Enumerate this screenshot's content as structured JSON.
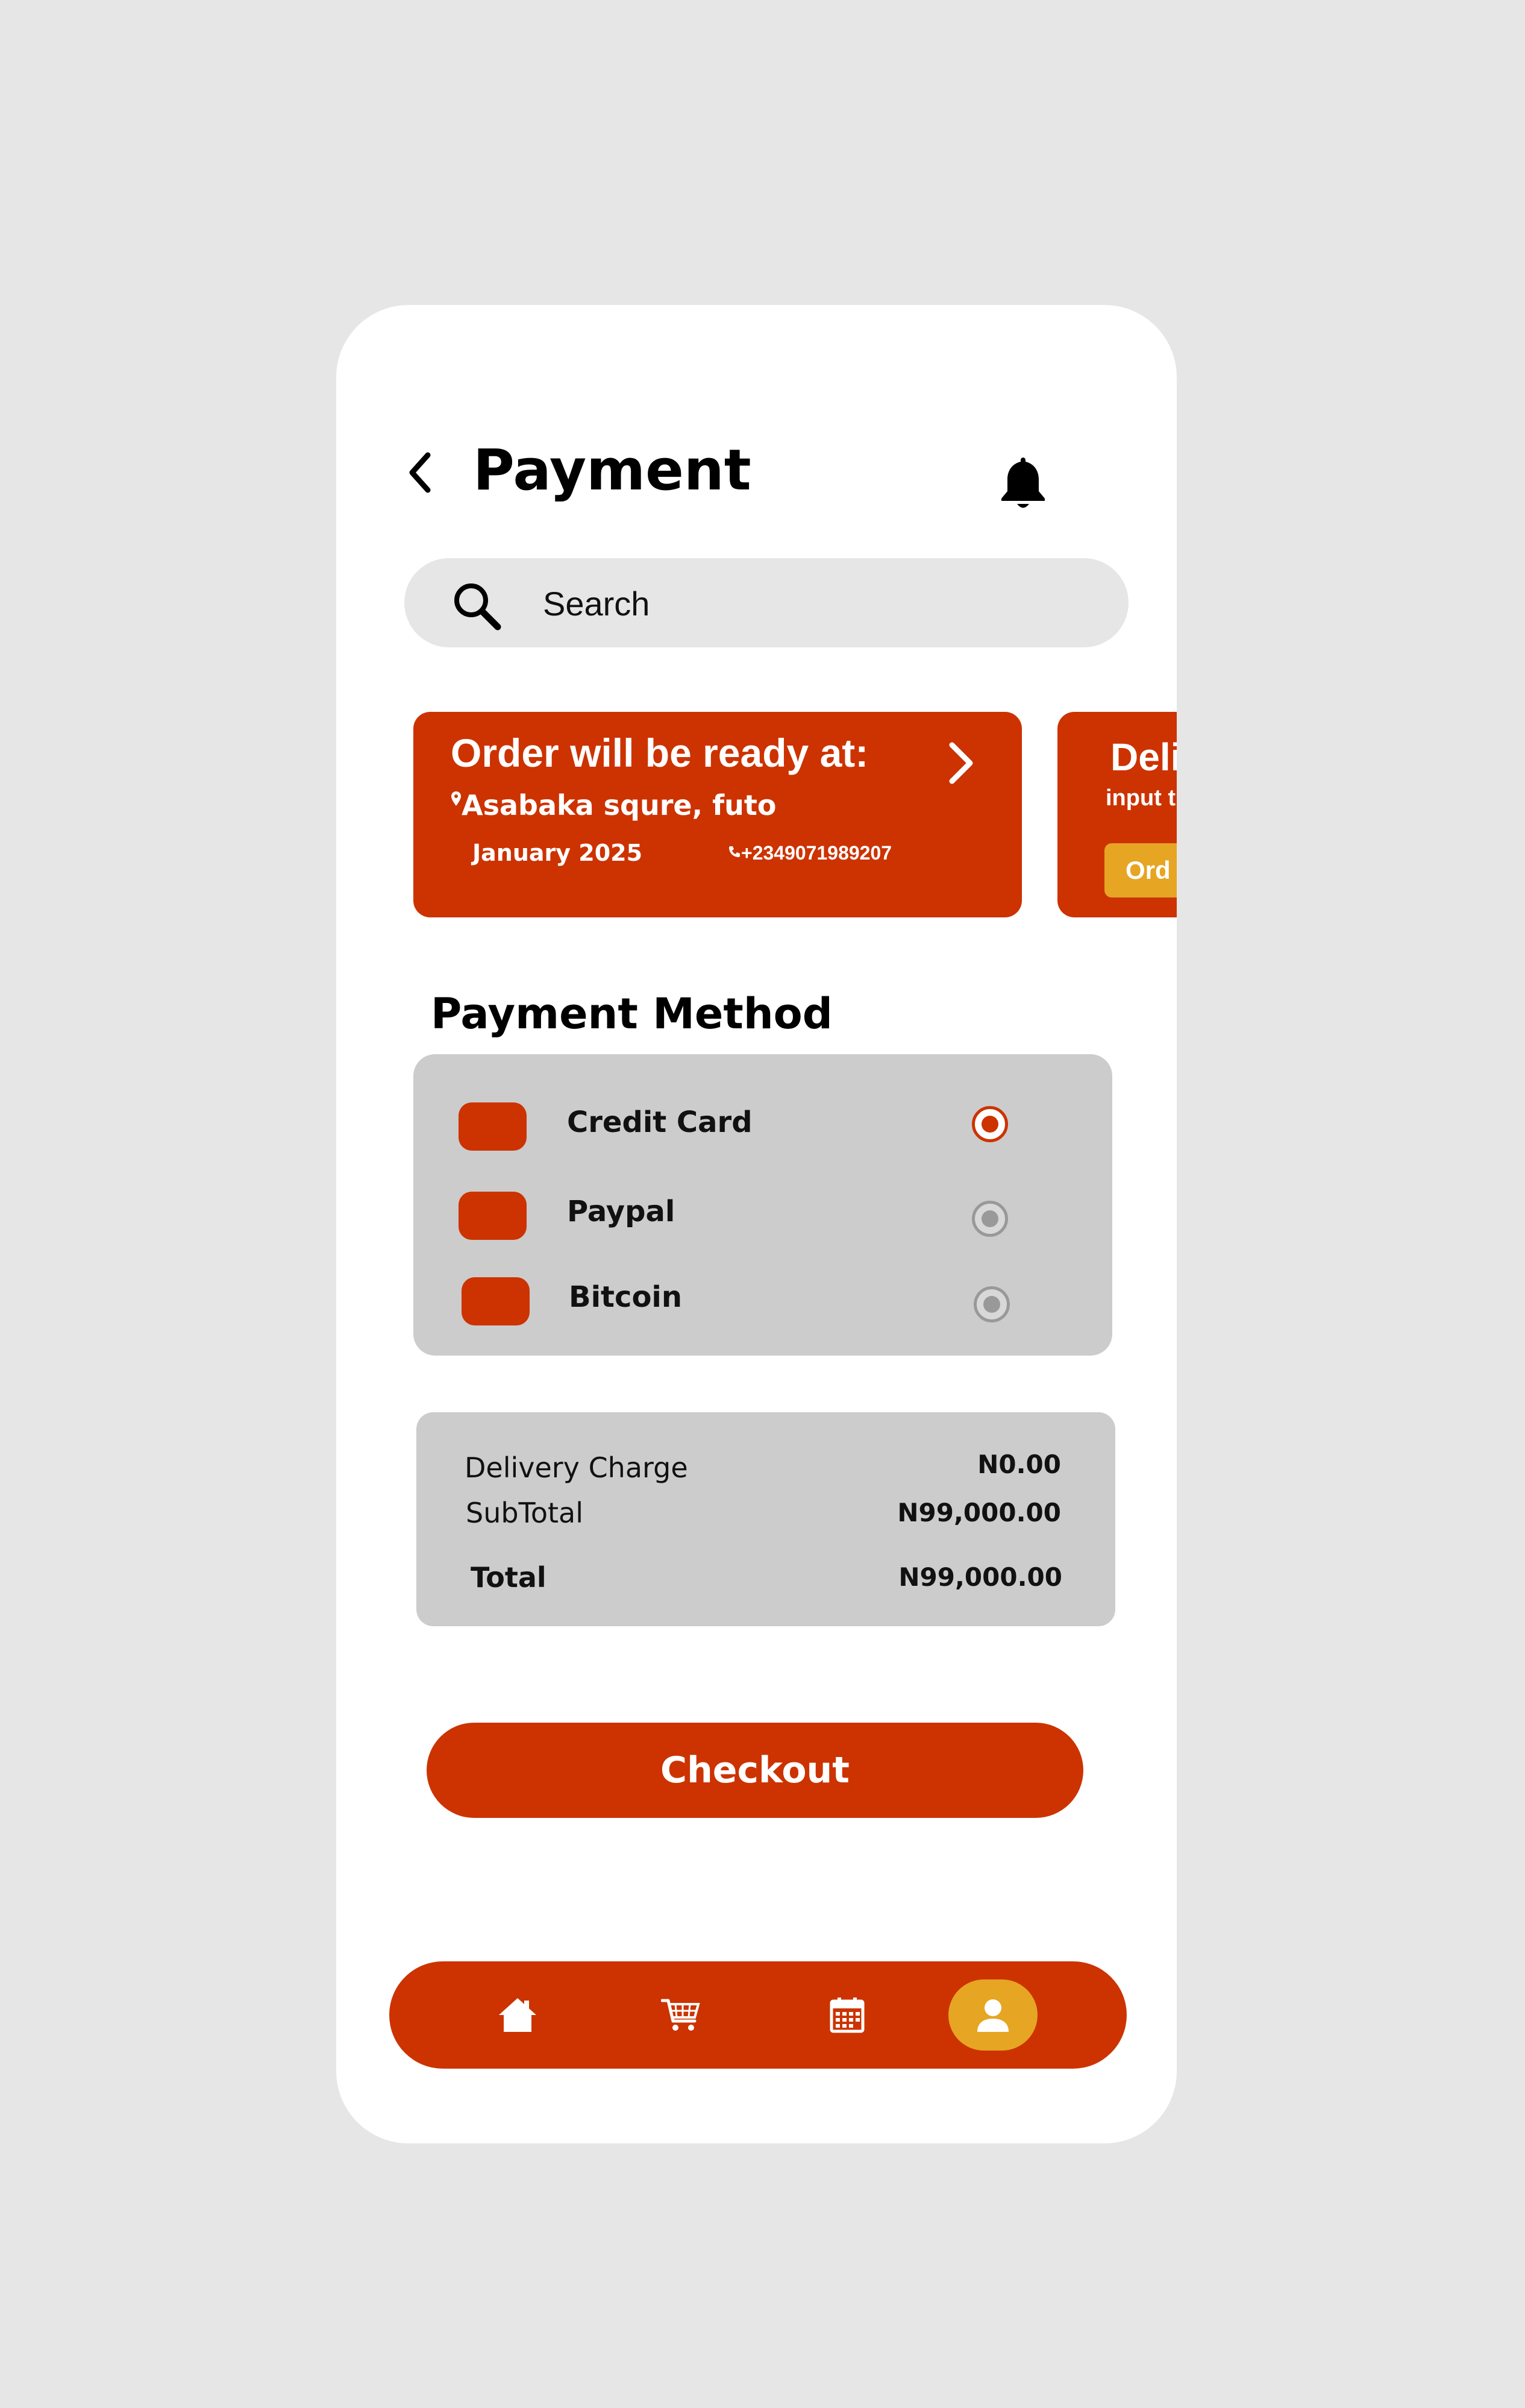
{
  "header": {
    "title": "Payment",
    "back_icon": "chevron-left-icon",
    "notification_icon": "bell-icon"
  },
  "search": {
    "placeholder": "Search",
    "icon": "search-icon"
  },
  "order_card": {
    "heading": "Order will be ready at:",
    "address": "Asabaka squre, futo",
    "date": "January 2025",
    "phone": "+2349071989207",
    "arrow_icon": "chevron-right-icon",
    "location_icon": "location-pin-icon",
    "phone_icon": "phone-icon"
  },
  "delivery_card": {
    "heading": "Deli",
    "subtext": "input t",
    "button_label": "Ord"
  },
  "payment_method": {
    "title": "Payment Method",
    "options": [
      {
        "label": "Credit Card",
        "selected": true
      },
      {
        "label": "Paypal",
        "selected": false
      },
      {
        "label": "Bitcoin",
        "selected": false
      }
    ]
  },
  "summary": {
    "delivery_label": "Delivery Charge",
    "delivery_value": "N0.00",
    "subtotal_label": "SubTotal",
    "subtotal_value": "N99,000.00",
    "total_label": "Total",
    "total_value": "N99,000.00"
  },
  "checkout": {
    "label": "Checkout"
  },
  "bottom_nav": {
    "items": [
      "home-icon",
      "cart-icon",
      "calendar-icon",
      "profile-icon"
    ],
    "active": "profile-icon"
  },
  "colors": {
    "primary": "#cc3300",
    "accent": "#e6a522",
    "panel": "#cccccc",
    "background": "#e6e6e6"
  }
}
